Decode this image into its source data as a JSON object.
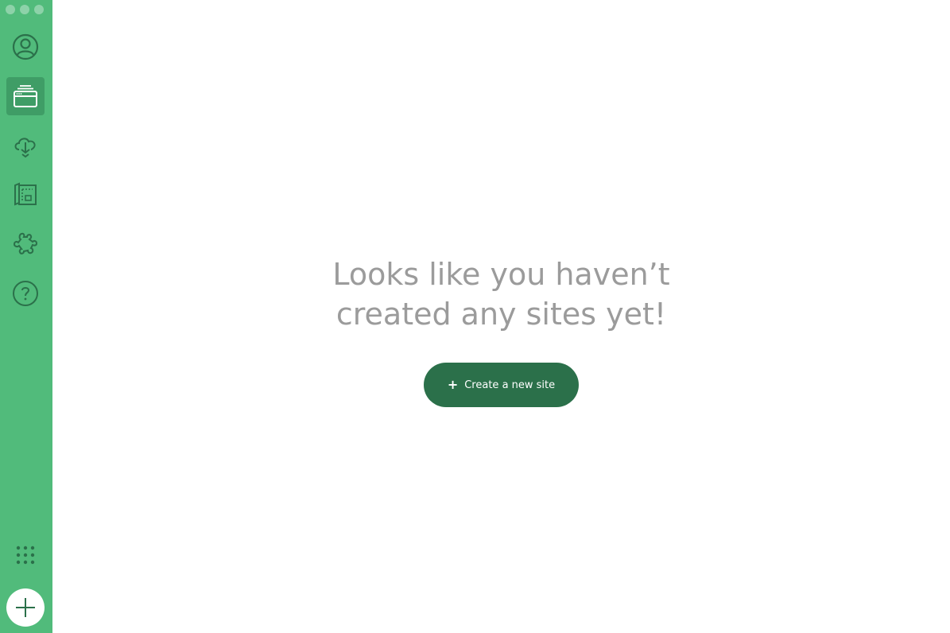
{
  "sidebar": {
    "background": "#51bb7b",
    "active_background": "#3f9d66",
    "icon_color": "#2b704a",
    "items": [
      {
        "icon": "user-avatar-icon",
        "active": false
      },
      {
        "icon": "sites-icon",
        "active": true
      },
      {
        "icon": "cloud-download-icon",
        "active": false
      },
      {
        "icon": "blueprint-icon",
        "active": false
      },
      {
        "icon": "addons-puzzle-icon",
        "active": false
      },
      {
        "icon": "help-icon",
        "active": false
      }
    ],
    "bottom": {
      "grid_icon": "grid-dots-icon",
      "add_icon": "plus-icon"
    }
  },
  "main": {
    "empty_state": {
      "line1": "Looks like you haven’t",
      "line2": "created any sites yet!",
      "button_icon": "+",
      "button_label": "Create a new site",
      "text_color": "#9b9b9b",
      "button_color": "#2b704a"
    }
  }
}
